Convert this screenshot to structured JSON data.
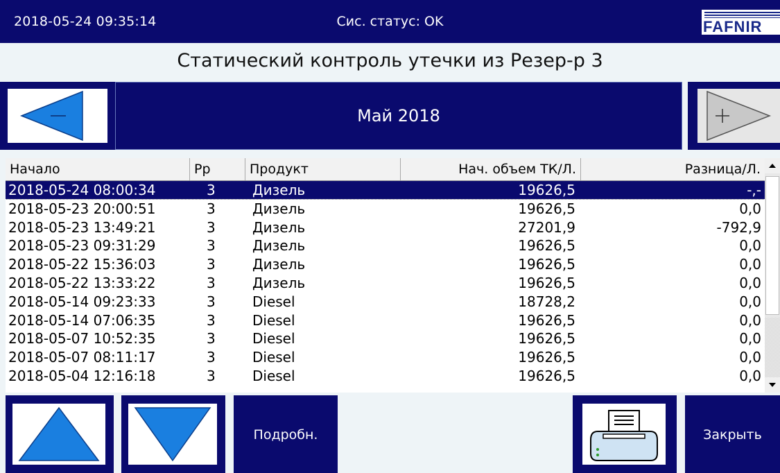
{
  "header": {
    "datetime": "2018-05-24  09:35:14",
    "system_status": "Сис. статус: OK",
    "logo_text": "FAFNIR"
  },
  "title": "Статический контроль утечки из Резер-р 3",
  "nav": {
    "month": "Май  2018",
    "prev_icon": "arrow-left-minus-icon",
    "next_icon": "arrow-right-plus-icon"
  },
  "table": {
    "columns": [
      "Начало",
      "Рр",
      "Продукт",
      "Нач. объем ТК/Л.",
      "Разница/Л."
    ],
    "rows": [
      {
        "start": "2018-05-24 08:00:34",
        "tank": "3",
        "product": "Дизель",
        "volume": "19626,5",
        "diff": "-,-",
        "selected": true
      },
      {
        "start": "2018-05-23 20:00:51",
        "tank": "3",
        "product": "Дизель",
        "volume": "19626,5",
        "diff": "0,0"
      },
      {
        "start": "2018-05-23 13:49:21",
        "tank": "3",
        "product": "Дизель",
        "volume": "27201,9",
        "diff": "-792,9"
      },
      {
        "start": "2018-05-23 09:31:29",
        "tank": "3",
        "product": "Дизель",
        "volume": "19626,5",
        "diff": "0,0"
      },
      {
        "start": "2018-05-22 15:36:03",
        "tank": "3",
        "product": "Дизель",
        "volume": "19626,5",
        "diff": "0,0"
      },
      {
        "start": "2018-05-22 13:33:22",
        "tank": "3",
        "product": "Дизель",
        "volume": "19626,5",
        "diff": "0,0"
      },
      {
        "start": "2018-05-14 09:23:33",
        "tank": "3",
        "product": "Diesel",
        "volume": "18728,2",
        "diff": "0,0"
      },
      {
        "start": "2018-05-14 07:06:35",
        "tank": "3",
        "product": "Diesel",
        "volume": "19626,5",
        "diff": "0,0"
      },
      {
        "start": "2018-05-07 10:52:35",
        "tank": "3",
        "product": "Diesel",
        "volume": "19626,5",
        "diff": "0,0"
      },
      {
        "start": "2018-05-07 08:11:17",
        "tank": "3",
        "product": "Diesel",
        "volume": "19626,5",
        "diff": "0,0"
      },
      {
        "start": "2018-05-04 12:16:18",
        "tank": "3",
        "product": "Diesel",
        "volume": "19626,5",
        "diff": "0,0"
      }
    ]
  },
  "footer": {
    "details_label": "Подробн.",
    "close_label": "Закрыть",
    "up_icon": "triangle-up-icon",
    "down_icon": "triangle-down-icon",
    "print_icon": "printer-icon"
  },
  "colors": {
    "panel": "#0a0a6e",
    "accent": "#1a7fe0"
  }
}
